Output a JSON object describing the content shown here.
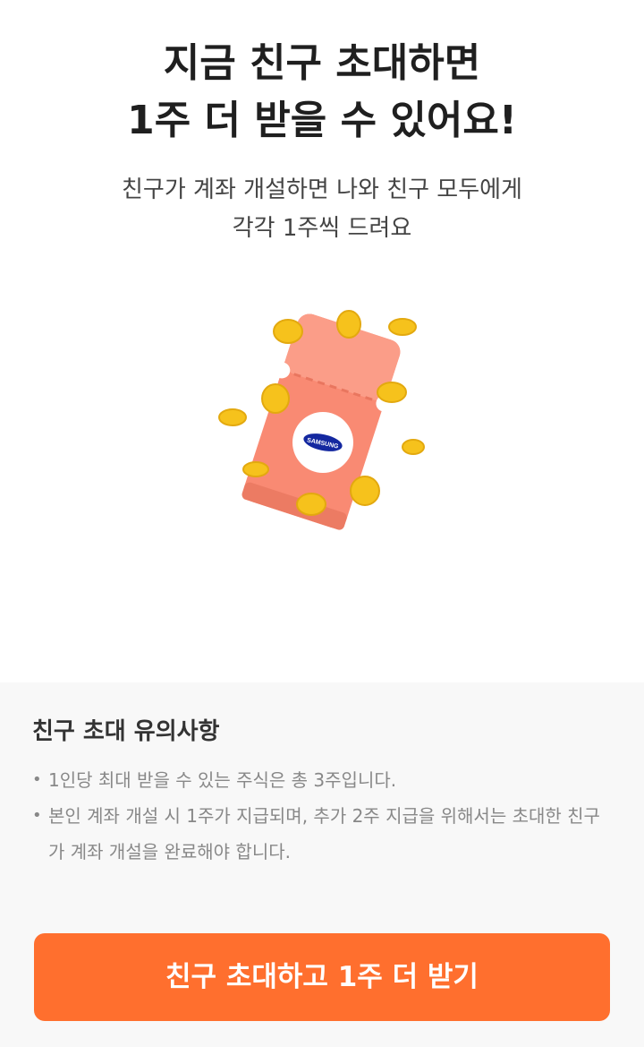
{
  "hero": {
    "headline_line1": "지금 친구 초대하면",
    "headline_line2": "1주 더 받을 수 있어요!",
    "subtitle_line1": "친구가 계좌 개설하면 나와 친구 모두에게",
    "subtitle_line2": "각각 1주씩 드려요"
  },
  "illustration": {
    "logo_text": "SAMSUNG",
    "colors": {
      "ticket": "#f98a73",
      "coin": "#f6c21c",
      "logo_blue": "#1428a0"
    }
  },
  "notice": {
    "title": "친구 초대 유의사항",
    "bullet": "•",
    "items": [
      "1인당 최대 받을 수 있는 주식은 총 3주입니다.",
      "본인 계좌 개설 시 1주가 지급되며, 추가 2주 지급을 위해서는 초대한 친구가 계좌 개설을 완료해야 합니다."
    ]
  },
  "cta": {
    "label": "친구 초대하고 1주 더 받기",
    "color": "#ff6f2e"
  }
}
